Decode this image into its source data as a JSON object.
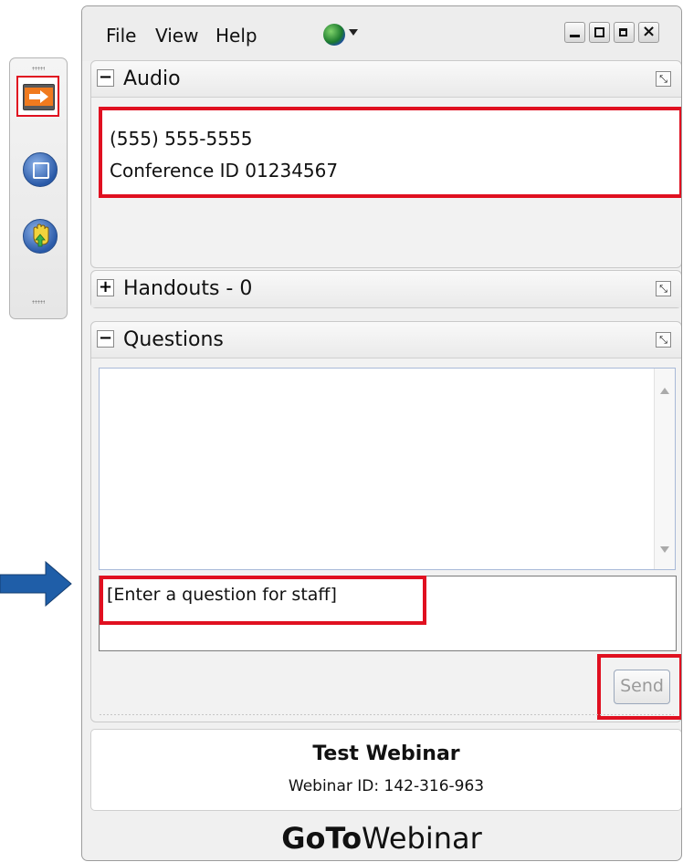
{
  "menu": {
    "file": "File",
    "view": "View",
    "help": "Help"
  },
  "audio": {
    "title": "Audio",
    "phone": "(555) 555-5555",
    "conference": "Conference ID 01234567"
  },
  "handouts": {
    "title": "Handouts - 0"
  },
  "questions": {
    "title": "Questions",
    "placeholder": "[Enter a question for staff]",
    "send_label": "Send"
  },
  "webinar": {
    "name": "Test Webinar",
    "id_line": "Webinar ID: 142-316-963"
  },
  "brand": {
    "bold": "GoTo",
    "light": "Webinar"
  },
  "icons": {
    "toolbar": [
      "show-hide-arrow-icon",
      "screen-icon",
      "raise-hand-icon"
    ],
    "menubar": [
      "globe-icon",
      "dropdown-arrow-icon"
    ],
    "window": [
      "minimize-icon",
      "maximize-icon",
      "popout-icon",
      "close-icon"
    ]
  },
  "colors": {
    "highlight_red": "#e01020",
    "arrow_blue": "#1f5ea8",
    "toolbar_orange": "#f07a1e"
  }
}
